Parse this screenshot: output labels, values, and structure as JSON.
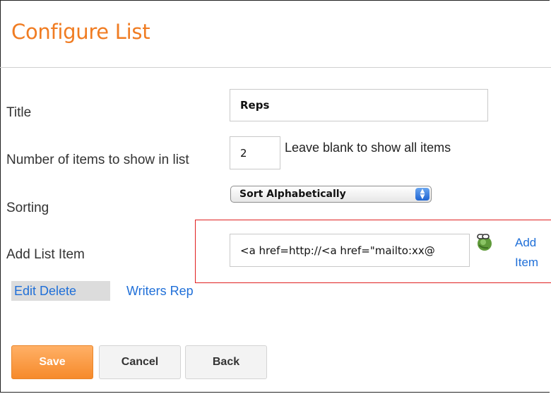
{
  "page": {
    "title": "Configure List"
  },
  "form": {
    "title_label": "Title",
    "title_value": "Reps",
    "count_label": "Number of items to show in list",
    "count_value": "2",
    "count_hint": "Leave blank to show all items",
    "sorting_label": "Sorting",
    "sorting_value": "Sort Alphabetically",
    "add_item_label": "Add List Item",
    "add_item_value": "<a href=http://<a href=\"mailto:xx@",
    "add_item_link_line1": "Add",
    "add_item_link_line2": "Item"
  },
  "list_item": {
    "edit_delete": "Edit Delete",
    "name": "Writers Rep"
  },
  "buttons": {
    "save": "Save",
    "cancel": "Cancel",
    "back": "Back"
  },
  "colors": {
    "accent": "#f07c22",
    "link": "#1f6fd8",
    "highlight": "#e02020"
  },
  "icons": {
    "add_item_icon": "globe-link-icon",
    "select_icon": "updown-arrows-icon"
  }
}
